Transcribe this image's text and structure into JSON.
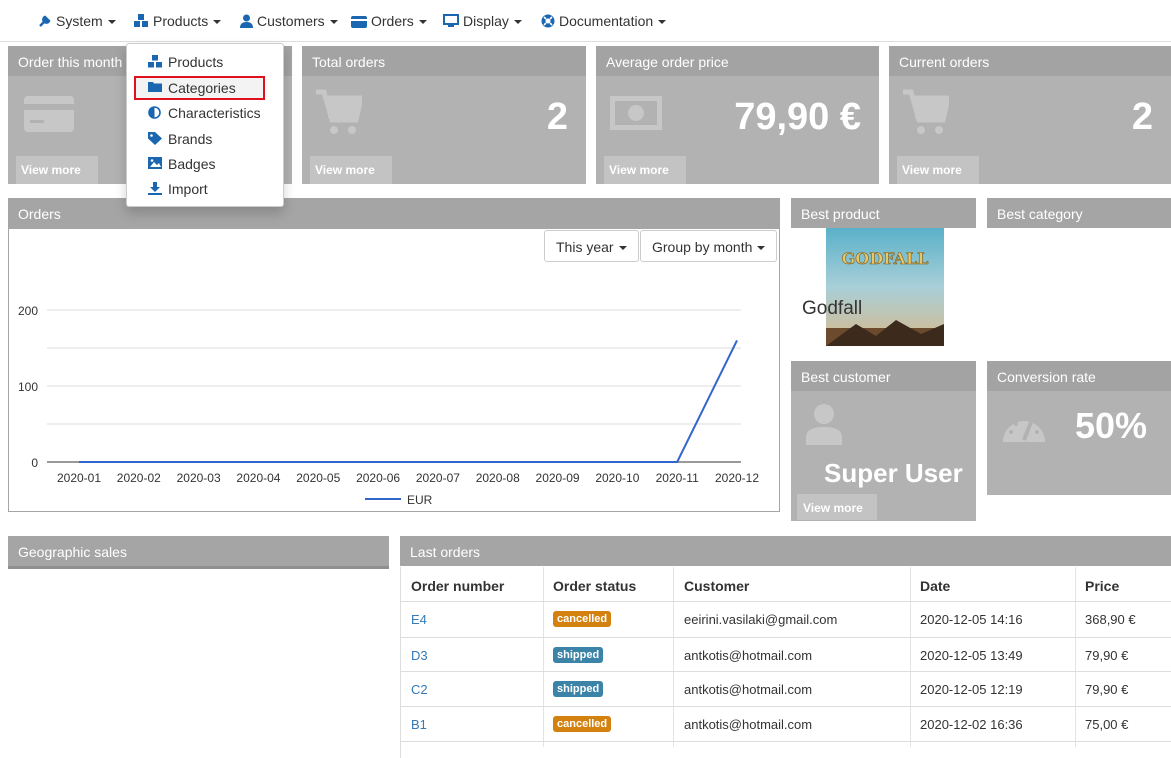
{
  "nav": {
    "items": [
      {
        "label": "System",
        "icon": "wrench-icon"
      },
      {
        "label": "Products",
        "icon": "cubes-icon"
      },
      {
        "label": "Customers",
        "icon": "user-icon"
      },
      {
        "label": "Orders",
        "icon": "credit-card-icon"
      },
      {
        "label": "Display",
        "icon": "monitor-icon"
      },
      {
        "label": "Documentation",
        "icon": "lifebuoy-icon"
      }
    ]
  },
  "products_menu": {
    "items": [
      {
        "label": "Products",
        "icon": "cubes-icon"
      },
      {
        "label": "Categories",
        "icon": "folder-icon",
        "highlighted": true
      },
      {
        "label": "Characteristics",
        "icon": "adjust-icon"
      },
      {
        "label": "Brands",
        "icon": "tag-icon"
      },
      {
        "label": "Badges",
        "icon": "image-icon"
      },
      {
        "label": "Import",
        "icon": "download-icon"
      }
    ]
  },
  "stats": [
    {
      "title": "Order this month",
      "value": "",
      "more": "View more",
      "icon": "credit-card-icon"
    },
    {
      "title": "Total orders",
      "value": "2",
      "more": "View more",
      "icon": "cart-icon"
    },
    {
      "title": "Average order price",
      "value": "79,90 €",
      "more": "View more",
      "icon": "money-icon"
    },
    {
      "title": "Current orders",
      "value": "2",
      "more": "View more",
      "icon": "cart-icon"
    }
  ],
  "orders_panel": {
    "title": "Orders",
    "period_button": "This year",
    "group_button": "Group by month"
  },
  "chart_data": {
    "type": "line",
    "x": [
      "2020-01",
      "2020-02",
      "2020-03",
      "2020-04",
      "2020-05",
      "2020-06",
      "2020-07",
      "2020-08",
      "2020-09",
      "2020-10",
      "2020-11",
      "2020-12"
    ],
    "series": [
      {
        "name": "EUR",
        "values": [
          0,
          0,
          0,
          0,
          0,
          0,
          0,
          0,
          0,
          0,
          0,
          160
        ],
        "color": "#3366cc"
      }
    ],
    "yticks": [
      "200",
      "100",
      "0"
    ],
    "ylim": [
      0,
      200
    ],
    "grid": true,
    "legend": "bottom"
  },
  "best_product": {
    "title": "Best product",
    "name": "Godfall",
    "image_text": "GODFALL"
  },
  "best_category": {
    "title": "Best category"
  },
  "best_customer": {
    "title": "Best customer",
    "name": "Super User",
    "more": "View more"
  },
  "conversion": {
    "title": "Conversion rate",
    "value": "50%"
  },
  "geo": {
    "title": "Geographic sales"
  },
  "last_orders": {
    "title": "Last orders",
    "columns": [
      "Order number",
      "Order status",
      "Customer",
      "Date",
      "Price"
    ],
    "rows": [
      {
        "number": "E4",
        "status": "cancelled",
        "customer": "eeirini.vasilaki@gmail.com",
        "date": "2020-12-05 14:16",
        "price": "368,90 €"
      },
      {
        "number": "D3",
        "status": "shipped",
        "customer": "antkotis@hotmail.com",
        "date": "2020-12-05 13:49",
        "price": "79,90 €"
      },
      {
        "number": "C2",
        "status": "shipped",
        "customer": "antkotis@hotmail.com",
        "date": "2020-12-05 12:19",
        "price": "79,90 €"
      },
      {
        "number": "B1",
        "status": "cancelled",
        "customer": "antkotis@hotmail.com",
        "date": "2020-12-02 16:36",
        "price": "75,00 €"
      }
    ]
  },
  "colors": {
    "cancelled": "#d4820f",
    "shipped": "#3b84a8",
    "line": "#3366cc",
    "highlight": "#e0101c"
  }
}
